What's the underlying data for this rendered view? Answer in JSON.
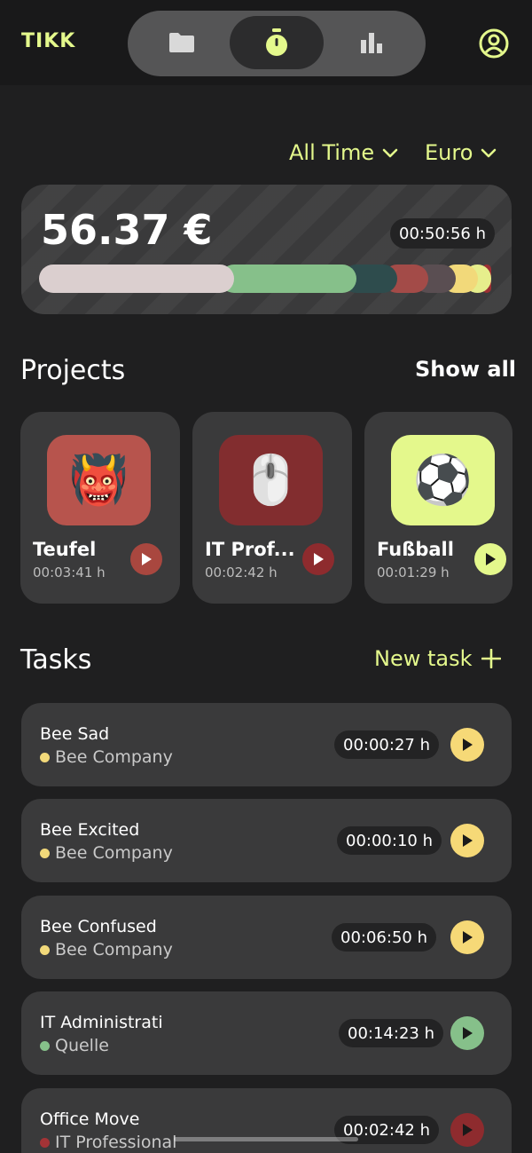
{
  "app": {
    "logo": "TIKK"
  },
  "nav": [
    {
      "label": "folder-icon",
      "icon": "folder-icon",
      "active": false
    },
    {
      "label": "stopwatch-icon",
      "icon": "stopwatch-icon",
      "active": true
    },
    {
      "label": "bar-chart-icon",
      "icon": "bar-chart-icon",
      "active": false
    }
  ],
  "filters": {
    "range": "All Time",
    "currency": "Euro"
  },
  "summary": {
    "amount": "56.37 €",
    "total_time": "00:50:56 h",
    "distribution": [
      {
        "color": "#dbcfcf",
        "share": 0.4
      },
      {
        "color": "#86c08a",
        "share": 0.27
      },
      {
        "color": "#2e4c4d",
        "share": 0.09
      },
      {
        "color": "#a34b48",
        "share": 0.07
      },
      {
        "color": "#5a4e52",
        "share": 0.06
      },
      {
        "color": "#f2d97a",
        "share": 0.05
      },
      {
        "color": "#e6ee8c",
        "share": 0.04
      },
      {
        "color": "#9c2f33",
        "share": 0.03
      },
      {
        "color": "#2aa7b0",
        "share": 0.01
      }
    ]
  },
  "projects": {
    "title": "Projects",
    "show_all": "Show all",
    "items": [
      {
        "name": "Teufel",
        "time": "00:03:41 h",
        "emoji": "👹",
        "tile_color": "#b7544d",
        "play_color": "#a9473f",
        "play_icon_color": "#ffffff"
      },
      {
        "name": "IT Prof...",
        "time": "00:02:42 h",
        "emoji": "🖱️",
        "tile_color": "#822d2f",
        "play_color": "#8e2b2e",
        "play_icon_color": "#ffffff"
      },
      {
        "name": "Fußball",
        "time": "00:01:29 h",
        "emoji": "⚽",
        "tile_color": "#e4f88c",
        "play_color": "#e4f88c",
        "play_icon_color": "#1a1a1a"
      }
    ]
  },
  "tasks": {
    "title": "Tasks",
    "new_task": "New task",
    "items": [
      {
        "name": "Bee Sad",
        "project": "Bee Company",
        "time": "00:00:27 h",
        "dot": "#f2d97a",
        "play_color": "#f6d977"
      },
      {
        "name": "Bee Excited",
        "project": "Bee Company",
        "time": "00:00:10 h",
        "dot": "#f2d97a",
        "play_color": "#f6d977"
      },
      {
        "name": "Bee Confused",
        "project": "Bee Company",
        "time": "00:06:50 h",
        "dot": "#f2d97a",
        "play_color": "#f6d977"
      },
      {
        "name": "IT Administrati",
        "project": "Quelle",
        "time": "00:14:23 h",
        "dot": "#86c08a",
        "play_color": "#86c08a"
      },
      {
        "name": "Office Move",
        "project": "IT Professional",
        "time": "00:02:42 h",
        "dot": "#a33336",
        "play_color": "#8e2b2e"
      }
    ]
  },
  "colors": {
    "accent": "#e4f88c",
    "background": "#1f1f20",
    "card": "#3a3a3b"
  }
}
